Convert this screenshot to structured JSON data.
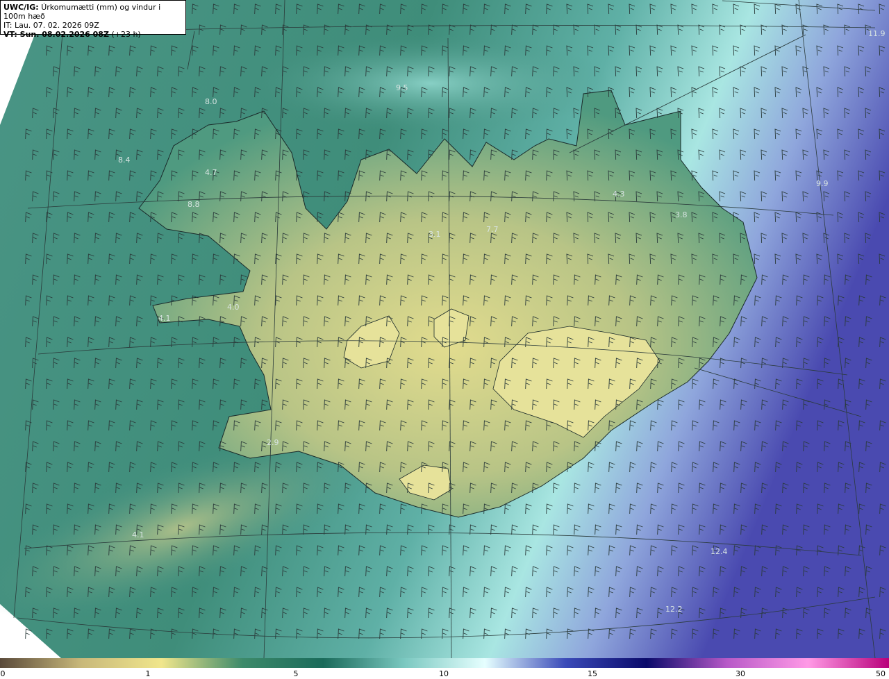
{
  "header": {
    "model_label": "UWC/IG:",
    "title": "Úrkomumætti (mm) og vindur i 100m hæð",
    "it_label": "IT:",
    "it_value": "Lau. 07. 02. 2026 09Z",
    "vt_label": "VT: Sun. 08.02.2026 08Z",
    "vt_suffix": "(+23 h)"
  },
  "colorbar": {
    "ticks": [
      "0",
      "1",
      "5",
      "10",
      "15",
      "30",
      "50"
    ],
    "colors": [
      "#5a4a3a",
      "#c8b87a",
      "#f0e68c",
      "#3d8a6a",
      "#1a6a5a",
      "#7ac8c0",
      "#e6ffff",
      "#3a4ab8",
      "#0a0a6a",
      "#b85ac8",
      "#ff9ae6",
      "#b8007a"
    ]
  },
  "map_labels": [
    "8.0",
    "8.4",
    "4.7",
    "4.0",
    "4.1",
    "3.1",
    "4.3",
    "3.8",
    "2.9",
    "4.1",
    "12.4",
    "12.2",
    "11.9",
    "9.5",
    "9.9",
    "7.7",
    "8.8"
  ],
  "colors": {
    "ocean_green": "#3d8a78",
    "land_yellow": "#d6d68a",
    "ocean_cyan": "#9fe0dc",
    "deep_purple": "#5a5ab8"
  }
}
